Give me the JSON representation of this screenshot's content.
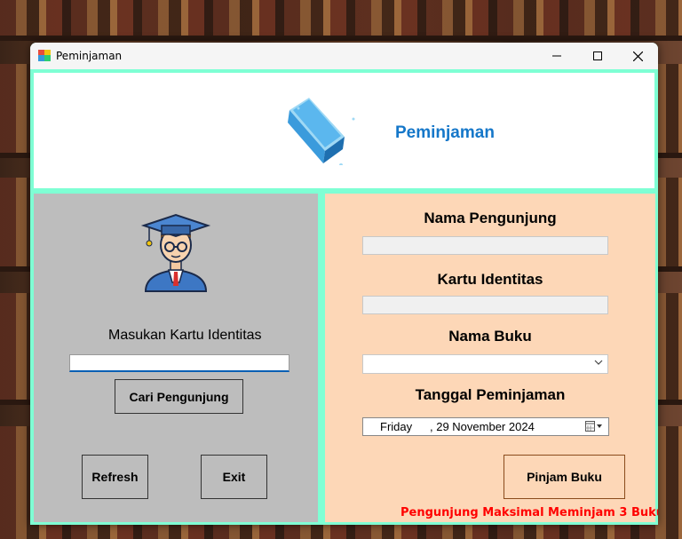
{
  "window": {
    "title": "Peminjaman"
  },
  "header": {
    "title": "Peminjaman"
  },
  "left": {
    "card_label": "Masukan Kartu Identitas",
    "card_value": "",
    "search_button": "Cari Pengunjung",
    "refresh_button": "Refresh",
    "exit_button": "Exit"
  },
  "right": {
    "visitor_label": "Nama Pengunjung",
    "visitor_value": "",
    "id_label": "Kartu Identitas",
    "id_value": "",
    "book_label": "Nama Buku",
    "book_selected": "",
    "date_label": "Tanggal Peminjaman",
    "date_day": "Friday",
    "date_value": ", 29 November 2024",
    "submit_button": "Pinjam Buku",
    "warning": "Pengunjung Maksimal Meminjam 3 Buku!"
  },
  "icons": [
    "app-icon",
    "book-icon",
    "graduate-avatar-icon",
    "minimize-icon",
    "maximize-icon",
    "close-icon",
    "calendar-icon",
    "chevron-down-icon"
  ]
}
